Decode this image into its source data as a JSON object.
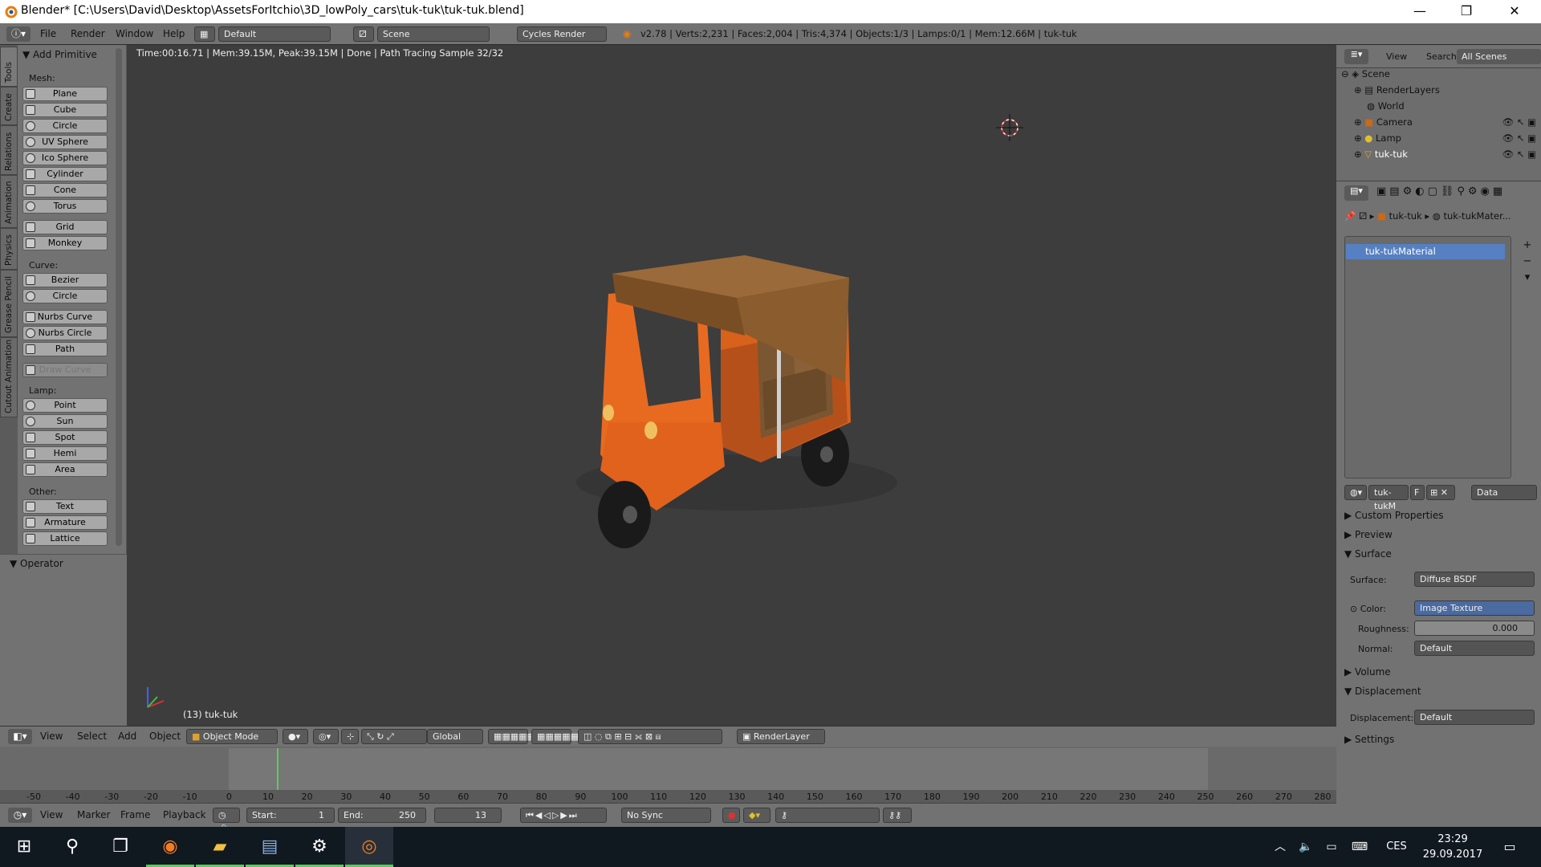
{
  "window": {
    "title": "Blender* [C:\\Users\\David\\Desktop\\AssetsForItchio\\3D_lowPoly_cars\\tuk-tuk\\tuk-tuk.blend]",
    "minimize": "—",
    "maximize": "❐",
    "close": "✕"
  },
  "infobar": {
    "menus": [
      "File",
      "Render",
      "Window",
      "Help"
    ],
    "layout": "Default",
    "scene": "Scene",
    "engine": "Cycles Render",
    "stats": "v2.78 | Verts:2,231 | Faces:2,004 | Tris:4,374 | Objects:1/3 | Lamps:0/1 | Mem:12.66M | tuk-tuk"
  },
  "tabs": [
    "Tools",
    "Create",
    "Relations",
    "Animation",
    "Physics",
    "Grease Pencil",
    "Cutout Animation"
  ],
  "shelf": {
    "panel_title": "Add Primitive",
    "mesh_label": "Mesh:",
    "mesh": [
      "Plane",
      "Cube",
      "Circle",
      "UV Sphere",
      "Ico Sphere",
      "Cylinder",
      "Cone",
      "Torus"
    ],
    "mesh2": [
      "Grid",
      "Monkey"
    ],
    "curve_label": "Curve:",
    "curve": [
      "Bezier",
      "Circle"
    ],
    "nurbs": [
      "Nurbs Curve",
      "Nurbs Circle",
      "Path"
    ],
    "draw_curve": "Draw Curve",
    "lamp_label": "Lamp:",
    "lamp": [
      "Point",
      "Sun",
      "Spot",
      "Hemi",
      "Area"
    ],
    "other_label": "Other:",
    "other": [
      "Text",
      "Armature",
      "Lattice"
    ],
    "operator": "Operator"
  },
  "viewport": {
    "info": "Time:00:16.71 | Mem:39.15M, Peak:39.15M | Done | Path Tracing Sample 32/32",
    "object_label": "(13) tuk-tuk"
  },
  "outliner": {
    "view": "View",
    "search": "Search",
    "filter": "All Scenes",
    "items": [
      "Scene",
      "RenderLayers",
      "World",
      "Camera",
      "Lamp",
      "tuk-tuk"
    ]
  },
  "properties": {
    "breadcrumb_obj": "tuk-tuk",
    "breadcrumb_mat": "tuk-tukMater...",
    "material_slot": "tuk-tukMaterial",
    "mat_short": "tuk-tukM",
    "fake_user": "F",
    "link": "Data",
    "sections": {
      "custom": "Custom Properties",
      "preview": "Preview",
      "surface": "Surface",
      "volume": "Volume",
      "displacement": "Displacement",
      "settings": "Settings"
    },
    "surface_label": "Surface:",
    "surface_value": "Diffuse BSDF",
    "color_label": "Color:",
    "color_value": "Image Texture",
    "roughness_label": "Roughness:",
    "roughness_value": "0.000",
    "normal_label": "Normal:",
    "normal_value": "Default",
    "disp_label": "Displacement:",
    "disp_value": "Default"
  },
  "header3d": {
    "menus": [
      "View",
      "Select",
      "Add",
      "Object"
    ],
    "mode": "Object Mode",
    "orientation": "Global",
    "layer": "RenderLayer"
  },
  "timeline": {
    "ticks": [
      "-50",
      "-40",
      "-30",
      "-20",
      "-10",
      "0",
      "10",
      "20",
      "30",
      "40",
      "50",
      "60",
      "70",
      "80",
      "90",
      "100",
      "110",
      "120",
      "130",
      "140",
      "150",
      "160",
      "170",
      "180",
      "190",
      "200",
      "210",
      "220",
      "230",
      "240",
      "250",
      "260",
      "270",
      "280"
    ],
    "menus": [
      "View",
      "Marker",
      "Frame",
      "Playback"
    ],
    "start_label": "Start:",
    "start": "1",
    "end_label": "End:",
    "end": "250",
    "current": "13",
    "sync": "No Sync"
  },
  "taskbar": {
    "lang": "CES",
    "time": "23:29",
    "date": "29.09.2017"
  },
  "colors": {
    "body_orange": "#e0621c",
    "roof_brown": "#8a5c2e",
    "selection_blue": "#5680c2"
  }
}
